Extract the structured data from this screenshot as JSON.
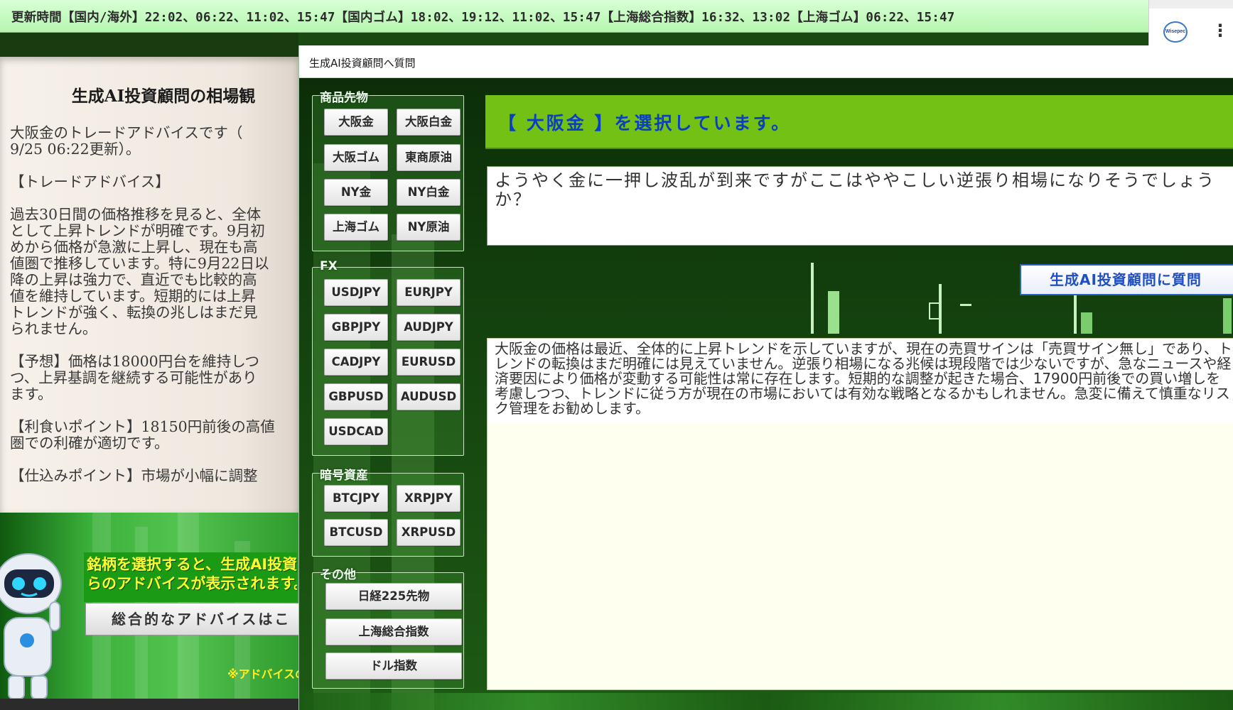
{
  "ticker": {
    "text": "更新時間【国内/海外】22:02、06:22、11:02、15:47【国内ゴム】18:02、19:12、11:02、15:47【上海総合指数】16:32、13:02【上海ゴム】06:22、15:47"
  },
  "corner": {
    "app_icon_label": "Wisepec",
    "menu_glyph": "⋮"
  },
  "left_panel": {
    "title": "生成AI投資顧問の相場観",
    "body": "大阪金のトレードアドバイスです（\n9/25 06:22更新）。\n\n【トレードアドバイス】\n\n過去30日間の価格推移を見ると、全体\nとして上昇トレンドが明確です。9月初\nめから価格が急激に上昇し、現在も高\n値圏で推移しています。特に9月22日以\n降の上昇は強力で、直近でも比較的高\n値を維持しています。短期的には上昇\nトレンドが強く、転換の兆しはまだ見\nられません。\n\n【予想】価格は18000円台を維持しつ\nつ、上昇基調を継続する可能性があり\nます。\n\n【利食いポイント】18150円前後の高値\n圏での利確が適切です。\n\n【仕込みポイント】市場が小幅に調整",
    "notice": "銘柄を選択すると、生成AI投資\nらのアドバイスが表示されます。",
    "overall_button": "総合的なアドバイスはこ",
    "advice_note": "※アドバイスの"
  },
  "dialog": {
    "title": "生成AI投資顧問へ質問",
    "groups": {
      "commodities": {
        "title": "商品先物",
        "buttons": [
          "大阪金",
          "大阪白金",
          "大阪ゴム",
          "東商原油",
          "NY金",
          "NY白金",
          "上海ゴム",
          "NY原油"
        ]
      },
      "fx": {
        "title": "FX",
        "buttons": [
          "USDJPY",
          "EURJPY",
          "GBPJPY",
          "AUDJPY",
          "CADJPY",
          "EURUSD",
          "GBPUSD",
          "AUDUSD",
          "USDCAD"
        ]
      },
      "crypto": {
        "title": "暗号資産",
        "buttons": [
          "BTCJPY",
          "XRPJPY",
          "BTCUSD",
          "XRPUSD"
        ]
      },
      "other": {
        "title": "その他",
        "buttons": [
          "日経225先物",
          "上海総合指数",
          "ドル指数"
        ]
      }
    },
    "selected_text": "【 大阪金 】を選択しています。",
    "question": "ようやく金に一押し波乱が到来ですがここはややこしい逆張り相場になりそうでしょうか？",
    "ask_button": "生成AI投資顧問に質問",
    "answer": "大阪金の価格は最近、全体的に上昇トレンドを示していますが、現在の売買サインは「売買サイン無し」であり、トレンドの転換はまだ明確には見えていません。逆張り相場になる兆候は現段階では少ないですが、急なニュースや経済要因により価格が変動する可能性は常に存在します。短期的な調整が起きた場合、17900円前後での買い増しを考慮しつつ、トレンドに従う方が現在の市場においては有効な戦略となるかもしれません。急変に備えて慎重なリスク管理をお勧めします。"
  },
  "colors": {
    "ticker_bg": "#c4f9bf",
    "banner_bg": "#74c116",
    "selected_text": "#0a3fc4",
    "answer_bg": "#fffff0",
    "notice_text": "#ffff33"
  }
}
